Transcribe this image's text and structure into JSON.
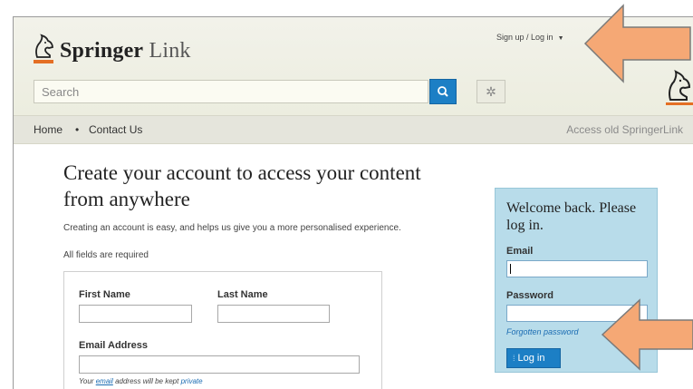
{
  "header": {
    "logo_bold": "Springer",
    "logo_light": "Link",
    "signup_label": "Sign up / Log in",
    "search_placeholder": "Search"
  },
  "nav": {
    "home": "Home",
    "separator": "•",
    "contact": "Contact Us",
    "old_link": "Access old SpringerLink"
  },
  "main": {
    "heading": "Create your account to access your content from anywhere",
    "intro": "Creating an account is easy, and helps us give you a more personalised experience.",
    "required": "All fields are required",
    "form": {
      "first_name_label": "First Name",
      "first_name_value": "",
      "last_name_label": "Last Name",
      "last_name_value": "",
      "email_label": "Email Address",
      "email_value": "",
      "note_prefix": "Your",
      "note_email": "email",
      "note_middle": "address will be kept",
      "note_private": "private"
    }
  },
  "login": {
    "welcome": "Welcome back. Please log in.",
    "email_label": "Email",
    "email_value": "",
    "password_label": "Password",
    "password_value": "",
    "forgot": "Forgotten password",
    "button": "Log in"
  },
  "colors": {
    "accent_blue": "#1c7fc5",
    "brand_orange": "#e46f24",
    "login_panel": "#b8dcea",
    "arrow_fill": "#f5a875"
  },
  "icons": {
    "search": "search-icon",
    "settings": "gear-icon",
    "logo": "springer-horse-icon",
    "annotation_arrows": "left-arrow-icon"
  }
}
